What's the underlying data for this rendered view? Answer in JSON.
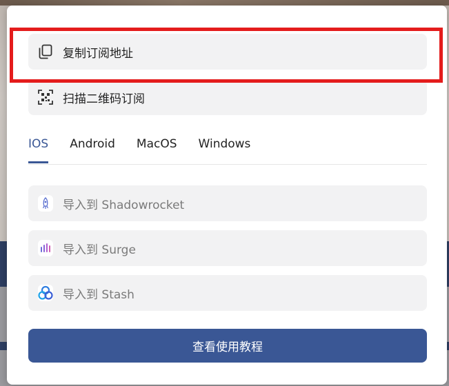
{
  "modal": {
    "copy_subscription_label": "复制订阅地址",
    "scan_qr_label": "扫描二维码订阅",
    "tabs": [
      {
        "label": "IOS",
        "active": true
      },
      {
        "label": "Android",
        "active": false
      },
      {
        "label": "MacOS",
        "active": false
      },
      {
        "label": "Windows",
        "active": false
      }
    ],
    "import_items": [
      {
        "label": "导入到 Shadowrocket",
        "icon": "shadowrocket-icon"
      },
      {
        "label": "导入到 Surge",
        "icon": "surge-icon"
      },
      {
        "label": "导入到 Stash",
        "icon": "stash-icon"
      }
    ],
    "tutorial_button_label": "查看使用教程"
  },
  "colors": {
    "accent": "#3a5795",
    "highlight": "#e41c1c",
    "row_bg": "#f2f2f3"
  }
}
